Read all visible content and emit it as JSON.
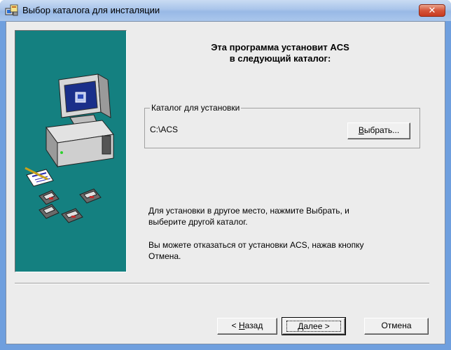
{
  "window": {
    "title": "Выбор каталога для инсталяции",
    "close_label": "✕"
  },
  "heading": {
    "line1": "Эта программа установит ACS",
    "line2": "в следующий каталог:"
  },
  "destination": {
    "group_label": "Каталог для установки",
    "path": "C:\\ACS",
    "browse_label_first": "В",
    "browse_label_rest": "ыбрать..."
  },
  "description": {
    "line1": "Для установки в другое место, нажмите Выбрать, и",
    "line2": "выберите другой каталог.",
    "line3": "Вы можете отказаться от установки ACS, нажав кнопку",
    "line4": "Отмена."
  },
  "buttons": {
    "back_prefix": "< ",
    "back_first": "Н",
    "back_rest": "азад",
    "next_first": "Д",
    "next_rest": "алее >",
    "cancel": "Отмена"
  },
  "colors": {
    "side_panel": "#148080",
    "title_bar": "#a9c4ea",
    "close_button": "#d5553a"
  }
}
